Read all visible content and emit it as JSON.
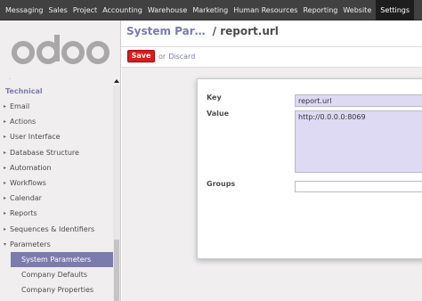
{
  "topbar": {
    "items": [
      "Messaging",
      "Sales",
      "Project",
      "Accounting",
      "Warehouse",
      "Marketing",
      "Human Resources",
      "Reporting",
      "Website",
      "Settings"
    ],
    "active": "Settings"
  },
  "sidebar": {
    "logo_text": "odoo",
    "section": "Technical",
    "items": [
      "Email",
      "Actions",
      "User Interface",
      "Database Structure",
      "Automation",
      "Workflows",
      "Calendar",
      "Reports",
      "Sequences & Identifiers"
    ],
    "open_item": "Parameters",
    "subitems": [
      "System Parameters",
      "Company Defaults",
      "Company Properties"
    ]
  },
  "breadcrumb": {
    "parent": "System Par…",
    "current": "/ report.url"
  },
  "toolbar": {
    "save_label": "Save",
    "or_label": "or",
    "discard_label": "Discard"
  },
  "form": {
    "key_label": "Key",
    "key_value": "report.url",
    "value_label": "Value",
    "value_value": "http://0.0.0.0:8069",
    "groups_label": "Groups",
    "groups_value": ""
  },
  "colors": {
    "accent": "#7c7bad",
    "save": "#dc1b1b",
    "topbar": "#414141"
  }
}
